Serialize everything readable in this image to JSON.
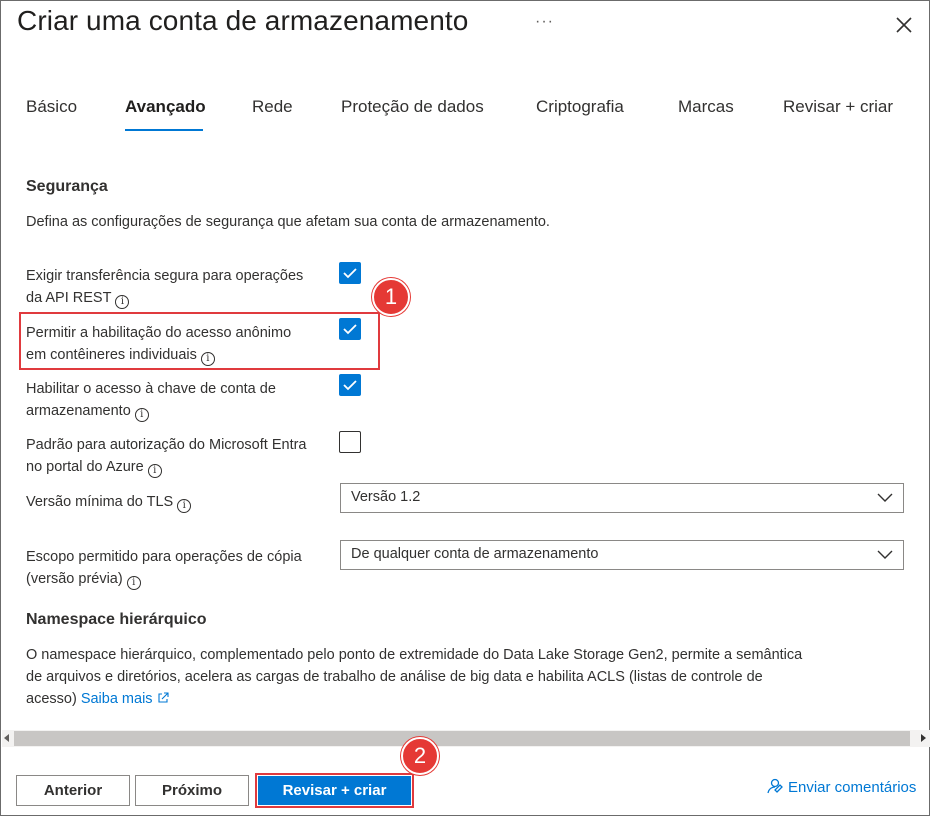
{
  "header": {
    "title": "Criar uma conta de armazenamento",
    "more_label": "···"
  },
  "tabs": [
    {
      "label": "Básico",
      "active": false
    },
    {
      "label": "Avançado",
      "active": true
    },
    {
      "label": "Rede",
      "active": false
    },
    {
      "label": "Proteção de dados",
      "active": false
    },
    {
      "label": "Criptografia",
      "active": false
    },
    {
      "label": "Marcas",
      "active": false
    },
    {
      "label": "Revisar + criar",
      "active": false
    }
  ],
  "security": {
    "heading": "Segurança",
    "description": "Defina as configurações de segurança que afetam sua conta de armazenamento.",
    "options": [
      {
        "line1": "Exigir transferência segura para operações",
        "line2": "da API REST",
        "checked": true
      },
      {
        "line1": "Permitir a habilitação do acesso anônimo",
        "line2": "em contêineres individuais",
        "checked": true
      },
      {
        "line1": "Habilitar o acesso à chave de conta de",
        "line2": "armazenamento",
        "checked": true
      },
      {
        "line1": "Padrão para autorização do Microsoft Entra",
        "line2": "no portal do Azure",
        "checked": false
      }
    ],
    "tls": {
      "label": "Versão mínima do TLS",
      "value": "Versão 1.2"
    },
    "copy_scope": {
      "line1": "Escopo permitido para operações de cópia",
      "line2": "(versão prévia)",
      "value": "De qualquer conta de armazenamento"
    }
  },
  "namespace": {
    "heading": "Namespace hierárquico",
    "line1": "O namespace hierárquico, complementado pelo ponto de extremidade do Data Lake Storage Gen2, permite a semântica",
    "line2": "de arquivos e diretórios, acelera as cargas de trabalho de análise de big data e habilita ACLS (listas de controle de",
    "line3": "acesso)",
    "link": "Saiba mais"
  },
  "footer": {
    "previous": "Anterior",
    "next": "Próximo",
    "review_create": "Revisar + criar",
    "feedback": "Enviar comentários"
  },
  "callouts": {
    "one": "1",
    "two": "2"
  },
  "colors": {
    "accent": "#0078d4",
    "callout": "#e53935"
  },
  "icons": {
    "close": "close-icon",
    "info": "info-icon",
    "chevron": "chevron-down-icon",
    "external": "external-link-icon",
    "feedback": "feedback-icon"
  }
}
